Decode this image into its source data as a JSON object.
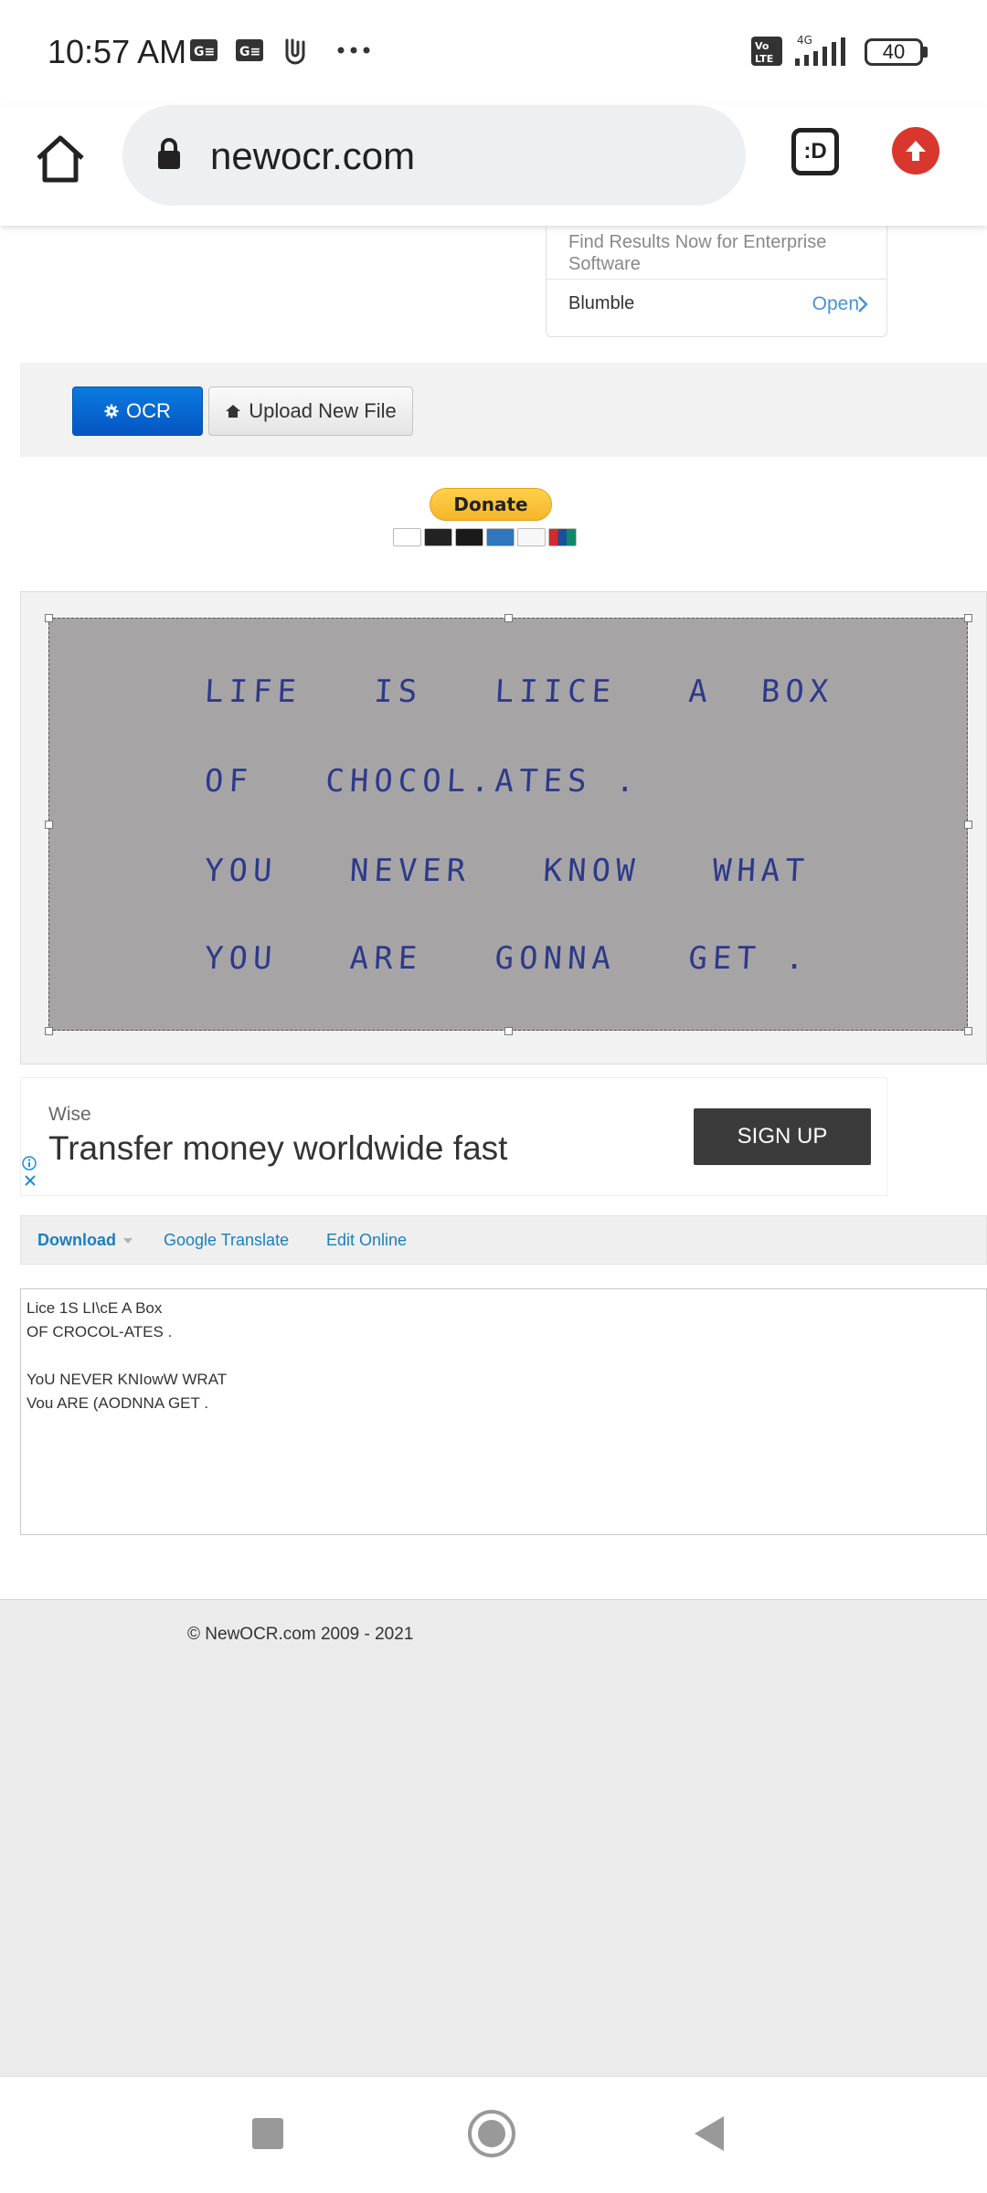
{
  "status_bar": {
    "time": "10:57 AM",
    "notification_icons": [
      "gmail-like-icon",
      "gmail-like-icon",
      "paperclip-icon",
      "more-dots-icon"
    ],
    "network": "4G",
    "volte": "Vo LTE",
    "battery": "40"
  },
  "browser": {
    "url": "newocr.com",
    "tabs_label": ":D"
  },
  "top_ad": {
    "subtitle": "Find Results Now for Enterprise Software",
    "advertiser": "Blumble",
    "open_label": "Open"
  },
  "toolbar": {
    "ocr_label": "OCR",
    "upload_label": "Upload New File"
  },
  "donate": {
    "label": "Donate",
    "cards": [
      "VISA",
      "MasterCard",
      "Maestro",
      "AMEX",
      "DISCOVER",
      "UnionPay"
    ]
  },
  "image": {
    "lines": [
      "LIFE   IS   LIICE   A  BOX",
      "OF   CHOCOL.ATES .",
      "YOU   NEVER   KNOW   WHAT",
      "YOU   ARE   GONNA   GET ."
    ]
  },
  "banner_ad": {
    "brand": "Wise",
    "headline": "Transfer money worldwide fast",
    "cta": "SIGN UP"
  },
  "actions": {
    "download": "Download",
    "translate": "Google Translate",
    "edit": "Edit Online"
  },
  "result_text": "Lice 1S LI\\cE A Box\nOF CROCOL-ATES .\n\nYoU NEVER KNIowW WRAT\nVou ARE (AODNNA GET .",
  "footer": {
    "copyright": "© NewOCR.com 2009 - 2021"
  },
  "colors": {
    "ocr_button": "#0a6fd8",
    "donate": "#ffc439",
    "link": "#1a7fc0",
    "update_button": "#d9372d"
  }
}
